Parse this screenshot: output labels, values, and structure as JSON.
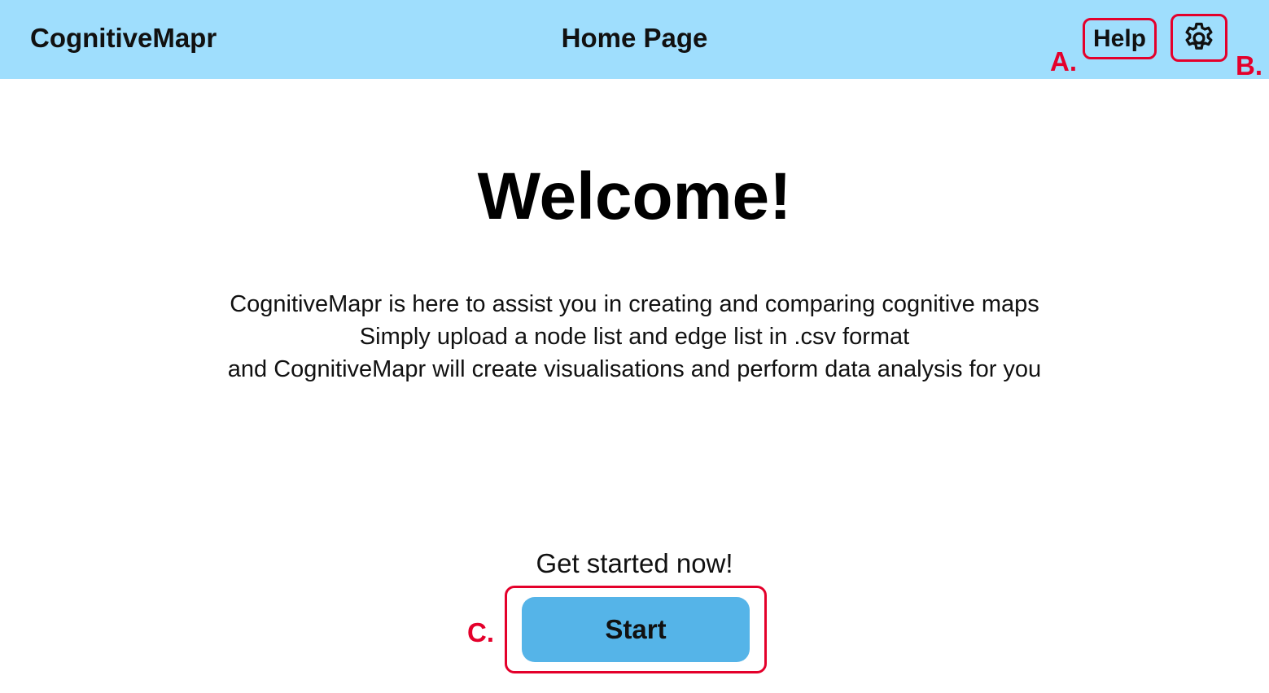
{
  "header": {
    "app_title": "CognitiveMapr",
    "page_title": "Home Page",
    "help_label": "Help",
    "settings_icon": "gear-icon",
    "background_color": "#9fdefd"
  },
  "annotations": {
    "a": "A.",
    "b": "B.",
    "c": "C.",
    "color": "#e4002b"
  },
  "main": {
    "heading": "Welcome!",
    "intro_lines": [
      "CognitiveMapr is here to assist you in creating and comparing cognitive maps",
      "Simply upload a node list and edge list in .csv format",
      "and CognitiveMapr will create visualisations and perform data analysis for you"
    ],
    "cta_text": "Get started now!",
    "start_label": "Start",
    "start_button_color": "#55b4e8"
  }
}
